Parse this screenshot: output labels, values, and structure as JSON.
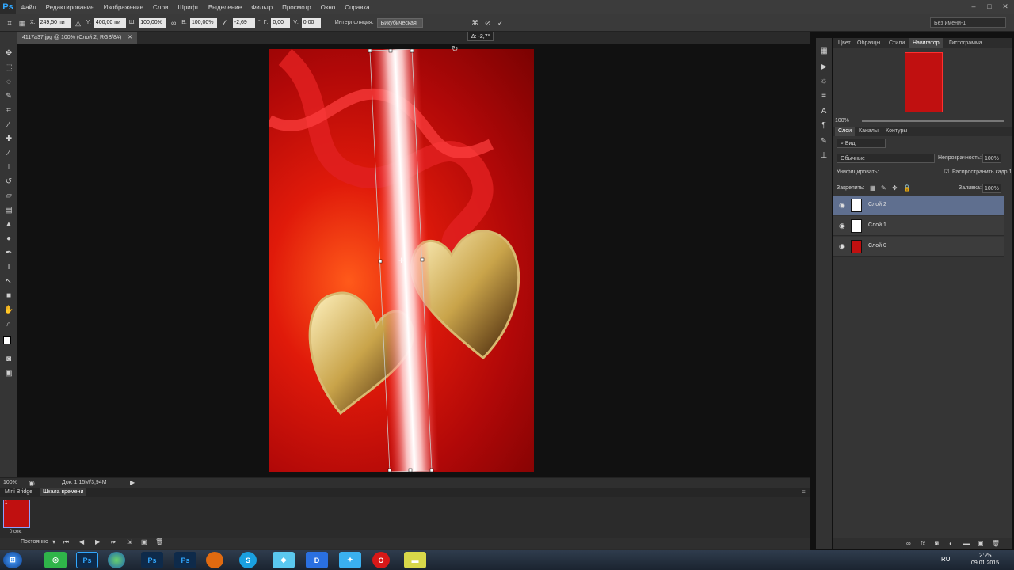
{
  "app": {
    "logo": "Ps"
  },
  "menu": [
    "Файл",
    "Редактирование",
    "Изображение",
    "Слои",
    "Шрифт",
    "Выделение",
    "Фильтр",
    "Просмотр",
    "Окно",
    "Справка"
  ],
  "window_controls": [
    "–",
    "□",
    "✕"
  ],
  "options": {
    "x_label": "X:",
    "x_value": "249,50 пи",
    "y_label": "Y:",
    "y_value": "400,00 пи",
    "w_label": "Ш:",
    "w_value": "100,00%",
    "h_label": "В:",
    "h_value": "100,00%",
    "angle_value": "-2,69",
    "hskew_label": "Г:",
    "hskew_value": "0,00",
    "vskew_label": "V:",
    "vskew_value": "0,00",
    "interp_label": "Интерполяция:",
    "interp_value": "Бикубическая",
    "workspace": "Без имени-1",
    "deg": "°"
  },
  "document": {
    "tab": "4117a37.jpg @ 100% (Слой 2, RGB/8#)",
    "tab_close": "✕",
    "angle_tooltip": "Δ: -2,7°"
  },
  "status": {
    "zoom": "100%",
    "doc_info": "Док: 1,15M/3,94M"
  },
  "bottom": {
    "tabs": [
      "Mini Bridge",
      "Шкала времени"
    ],
    "frame_time": "0 сек.",
    "loop": "Постоянно"
  },
  "panels": {
    "top_tabs": [
      "Цвет",
      "Образцы",
      "Стили",
      "Навигатор",
      "Гистограмма"
    ],
    "nav_zoom": "100%",
    "layer_tabs": [
      "Слои",
      "Каналы",
      "Контуры"
    ],
    "filter_kind": "Вид",
    "blend_mode": "Обычные",
    "opacity_label": "Непрозрачность:",
    "opacity_value": "100%",
    "unify_label": "Унифицировать:",
    "propagate_label": "Распространить кадр 1",
    "lock_label": "Закрепить:",
    "fill_label": "Заливка:",
    "fill_value": "100%",
    "layers": [
      {
        "name": "Слой 2",
        "selected": true
      },
      {
        "name": "Слой 1",
        "selected": false
      },
      {
        "name": "Слой 0",
        "selected": false
      }
    ]
  },
  "taskbar": {
    "lang": "RU",
    "time": "2:25",
    "date": "09.01.2015",
    "apps": [
      "Ps",
      "Ps",
      "Ps"
    ]
  },
  "colors": {
    "accent": "#31a8ff",
    "selected_layer": "#5f6f8f",
    "canvas": "#d01010"
  }
}
